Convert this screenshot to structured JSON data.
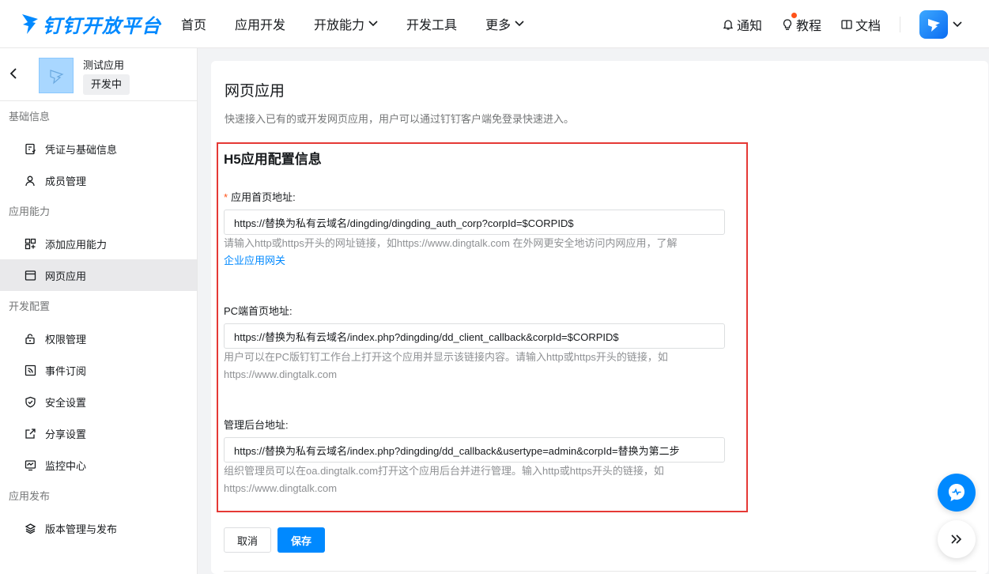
{
  "colors": {
    "brand": "#0089ff",
    "highlight": "#e53935",
    "required": "#ff5219"
  },
  "header": {
    "brand_name": "钉钉开放平台",
    "nav": [
      {
        "label": "首页"
      },
      {
        "label": "应用开发"
      },
      {
        "label": "开放能力"
      },
      {
        "label": "开发工具"
      },
      {
        "label": "更多"
      }
    ],
    "tools": {
      "notify": "通知",
      "tutorial": "教程",
      "docs": "文档"
    }
  },
  "sidebar": {
    "app_name": "测试应用",
    "app_status": "开发中",
    "groups": [
      {
        "title": "基础信息",
        "items": [
          {
            "label": "凭证与基础信息",
            "icon": "credential-icon"
          },
          {
            "label": "成员管理",
            "icon": "user-icon"
          }
        ]
      },
      {
        "title": "应用能力",
        "items": [
          {
            "label": "添加应用能力",
            "icon": "grid-add-icon"
          },
          {
            "label": "网页应用",
            "icon": "webpage-icon"
          }
        ]
      },
      {
        "title": "开发配置",
        "items": [
          {
            "label": "权限管理",
            "icon": "lock-icon"
          },
          {
            "label": "事件订阅",
            "icon": "rss-icon"
          },
          {
            "label": "安全设置",
            "icon": "shield-icon"
          },
          {
            "label": "分享设置",
            "icon": "share-icon"
          },
          {
            "label": "监控中心",
            "icon": "monitor-icon"
          }
        ]
      },
      {
        "title": "应用发布",
        "items": [
          {
            "label": "版本管理与发布",
            "icon": "layers-icon"
          }
        ]
      }
    ],
    "active_item": "网页应用"
  },
  "main": {
    "title": "网页应用",
    "description": "快速接入已有的或开发网页应用，用户可以通过钉钉客户端免登录快速进入。",
    "section_title": "H5应用配置信息",
    "fields": [
      {
        "required": "*",
        "label": "应用首页地址:",
        "value": "https://替换为私有云域名/dingding/dingding_auth_corp?corpId=$CORPID$",
        "help": "请输入http或https开头的网址链接，如https://www.dingtalk.com 在外网更安全地访问内网应用，了解",
        "help_link": "企业应用网关"
      },
      {
        "label": "PC端首页地址:",
        "value": "https://替换为私有云域名/index.php?dingding/dd_client_callback&corpId=$CORPID$",
        "help": "用户可以在PC版钉钉工作台上打开这个应用并显示该链接内容。请输入http或https开头的链接，如https://www.dingtalk.com"
      },
      {
        "label": "管理后台地址:",
        "value": "https://替换为私有云域名/index.php?dingding/dd_callback&usertype=admin&corpId=替换为第二步",
        "help": "组织管理员可以在oa.dingtalk.com打开这个应用后台并进行管理。输入http或https开头的链接，如https://www.dingtalk.com"
      }
    ],
    "cancel_label": "取消",
    "save_label": "保存"
  }
}
